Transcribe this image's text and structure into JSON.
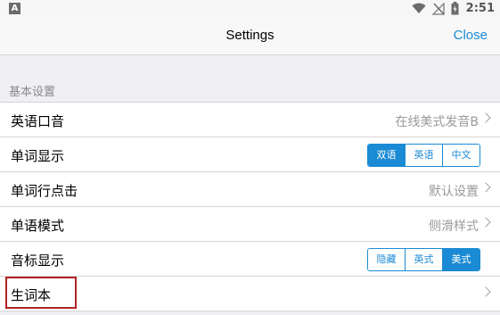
{
  "status_bar": {
    "app_icon_letter": "A",
    "time": "2:51",
    "icons": [
      "wifi-icon",
      "no-signal-icon",
      "battery-icon"
    ]
  },
  "nav": {
    "title": "Settings",
    "close_label": "Close"
  },
  "section": {
    "header": "基本设置"
  },
  "rows": [
    {
      "label": "英语口音",
      "value": "在线美式发音B",
      "type": "disclosure"
    },
    {
      "label": "单词显示",
      "type": "segmented",
      "options": [
        "双语",
        "英语",
        "中文"
      ],
      "selected": "双语"
    },
    {
      "label": "单词行点击",
      "value": "默认设置",
      "type": "disclosure"
    },
    {
      "label": "单语模式",
      "value": "侧滑样式",
      "type": "disclosure"
    },
    {
      "label": "音标显示",
      "type": "segmented",
      "options": [
        "隐藏",
        "英式",
        "美式"
      ],
      "selected": "美式"
    },
    {
      "label": "生词本",
      "value": "",
      "type": "disclosure"
    }
  ],
  "colors": {
    "accent": "#1a8ad4",
    "highlight_box": "#b22222",
    "background": "#efeff4"
  }
}
